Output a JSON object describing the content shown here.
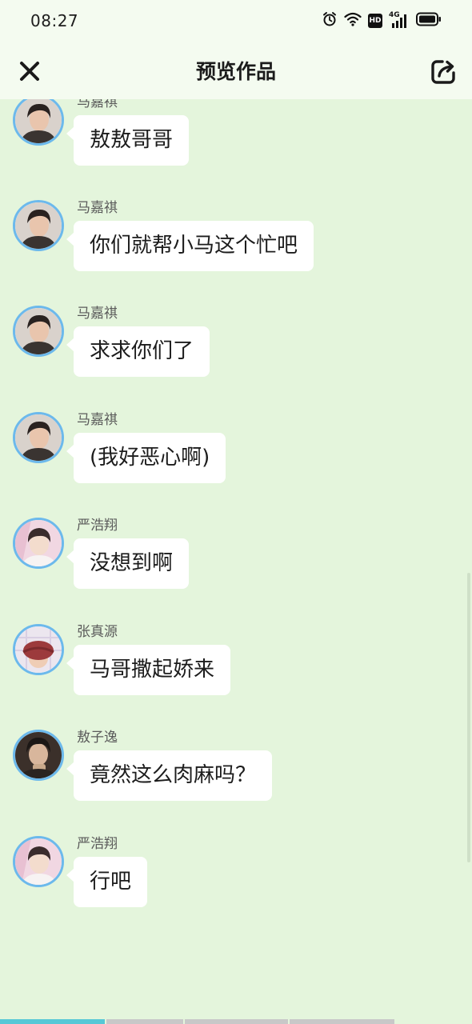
{
  "status_bar": {
    "time": "08:27",
    "icons": [
      "alarm-icon",
      "wifi-icon",
      "hd-badge",
      "4g-signal-icon",
      "battery-icon"
    ],
    "hd_label": "HD",
    "network_label": "4G"
  },
  "header": {
    "title": "预览作品",
    "close_icon": "close-icon",
    "share_icon": "share-icon"
  },
  "messages": [
    {
      "sender": "马嘉祺",
      "text": "敖敖哥哥",
      "avatar": "male-avatar-dark-hair"
    },
    {
      "sender": "马嘉祺",
      "text": "你们就帮小马这个忙吧",
      "avatar": "male-avatar-dark-hair"
    },
    {
      "sender": "马嘉祺",
      "text": "求求你们了",
      "avatar": "male-avatar-dark-hair"
    },
    {
      "sender": "马嘉祺",
      "text": "(我好恶心啊)",
      "avatar": "male-avatar-dark-hair"
    },
    {
      "sender": "严浩翔",
      "text": "没想到啊",
      "avatar": "pink-background-avatar"
    },
    {
      "sender": "张真源",
      "text": "马哥撒起娇来",
      "avatar": "red-hat-avatar"
    },
    {
      "sender": "敖子逸",
      "text": "竟然这么肉麻吗？",
      "avatar": "dark-portrait-avatar"
    },
    {
      "sender": "严浩翔",
      "text": "行吧",
      "avatar": "pink-background-avatar"
    }
  ],
  "progress": {
    "segments": 4,
    "active_segment": 1,
    "active_fill": 1.0
  },
  "colors": {
    "background": "#e4f5dc",
    "header_bg": "#f4fbf0",
    "bubble_bg": "#ffffff",
    "avatar_border": "#6cb9ec",
    "progress_active": "#56c8d6",
    "progress_inactive": "#c8c8c8"
  }
}
